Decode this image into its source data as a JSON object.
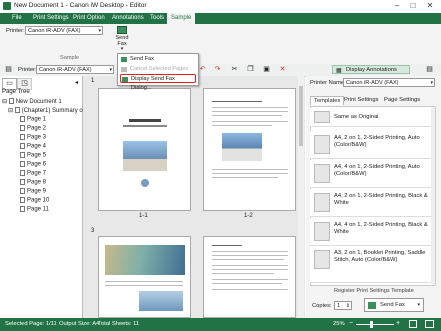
{
  "window": {
    "title": "New Document 1 - Canon iW Desktop - Editor"
  },
  "menu": {
    "items": [
      "File",
      "Print Settings",
      "Print Option",
      "Annotations",
      "Tools",
      "Sample"
    ]
  },
  "ribbon": {
    "printer_label": "Printer:",
    "printer_value": "Canon iR-ADV (FAX)",
    "send_fax_label": "Send Fax",
    "group_label": "Sample"
  },
  "dropdown": {
    "items": [
      "Send Fax",
      "Cancel Selected Pages",
      "Display Send Fax Dialog..."
    ]
  },
  "subbar": {
    "printer_label": "Printer:",
    "printer_value": "Canon iR-ADV (FAX)",
    "display_annotations": "Display Annotations"
  },
  "tree": {
    "label": "Page Tree",
    "items": [
      "New Document 1",
      "(Chapter1) Summary of R",
      "Page 1",
      "Page 2",
      "Page 3",
      "Page 4",
      "Page 5",
      "Page 6",
      "Page 7",
      "Page 8",
      "Page 9",
      "Page 10",
      "Page 11"
    ]
  },
  "pages": {
    "labels": [
      "1",
      "1-1",
      "1-2",
      "3"
    ]
  },
  "right": {
    "printer_label": "Printer Name:",
    "printer_value": "Canon iR-ADV (FAX)",
    "tabs": [
      "Templates",
      "Print Settings",
      "Page Settings"
    ],
    "templates": [
      "Same as Original",
      "A4, 2 on 1, 2-Sided Printing, Auto (Color/B&W)",
      "A4, 4 on 1, 2-Sided Printing, Auto (Color/B&W)",
      "A4, 2 on 1, 2-Sided Printing, Black & White",
      "A4, 4 on 1, 2-Sided Printing, Black & White",
      "A3, 2 on 1, Booklet Printing, Saddle Stitch, Auto (Color/B&W)"
    ],
    "register_link": "Register Print Settings Template",
    "copies_label": "Copies:",
    "copies_value": "1",
    "send_fax_button": "Send Fax"
  },
  "status": {
    "selected_page": "Selected Page: 1/11",
    "output_size": "Output Size: A4",
    "total_sheets": "Total Sheets: 11",
    "zoom": "25%"
  },
  "colors": {
    "accent": "#217346",
    "highlight": "#e02020"
  }
}
